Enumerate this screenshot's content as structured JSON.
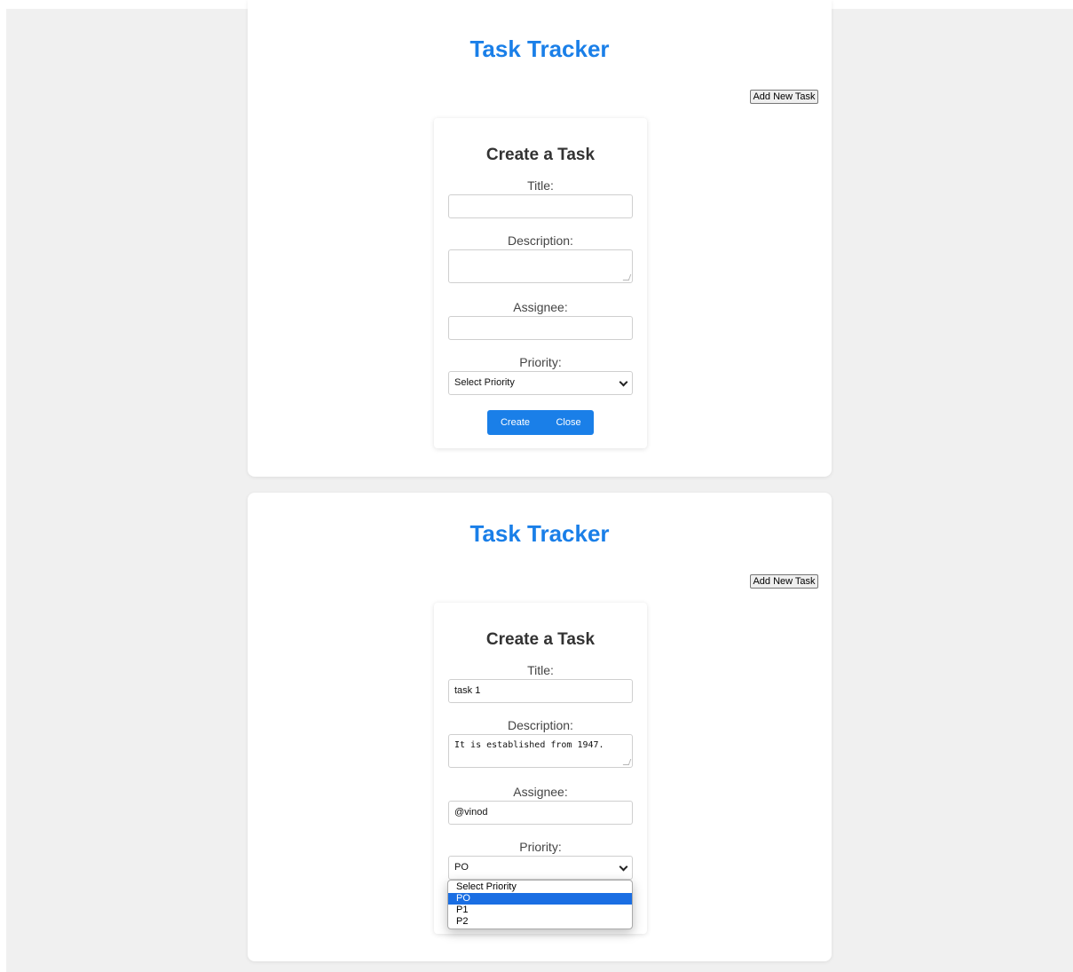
{
  "views": [
    {
      "app_title": "Task Tracker",
      "add_button_label": "Add New Task",
      "form": {
        "heading": "Create a Task",
        "title_label": "Title:",
        "title_value": "",
        "description_label": "Description:",
        "description_value": "",
        "assignee_label": "Assignee:",
        "assignee_value": "",
        "priority_label": "Priority:",
        "priority_selected": "Select Priority",
        "create_label": "Create",
        "close_label": "Close"
      }
    },
    {
      "app_title": "Task Tracker",
      "add_button_label": "Add New Task",
      "form": {
        "heading": "Create a Task",
        "title_label": "Title:",
        "title_value": "task 1",
        "description_label": "Description:",
        "description_value": "It is established from 1947.",
        "assignee_label": "Assignee:",
        "assignee_value": "@vinod",
        "priority_label": "Priority:",
        "priority_selected": "PO",
        "priority_options": [
          "Select Priority",
          "PO",
          "P1",
          "P2"
        ],
        "highlighted_option": "PO"
      }
    }
  ],
  "colors": {
    "accent": "#1a7fe8",
    "highlight": "#1a6ee3",
    "page_background": "#f0f0f0"
  }
}
